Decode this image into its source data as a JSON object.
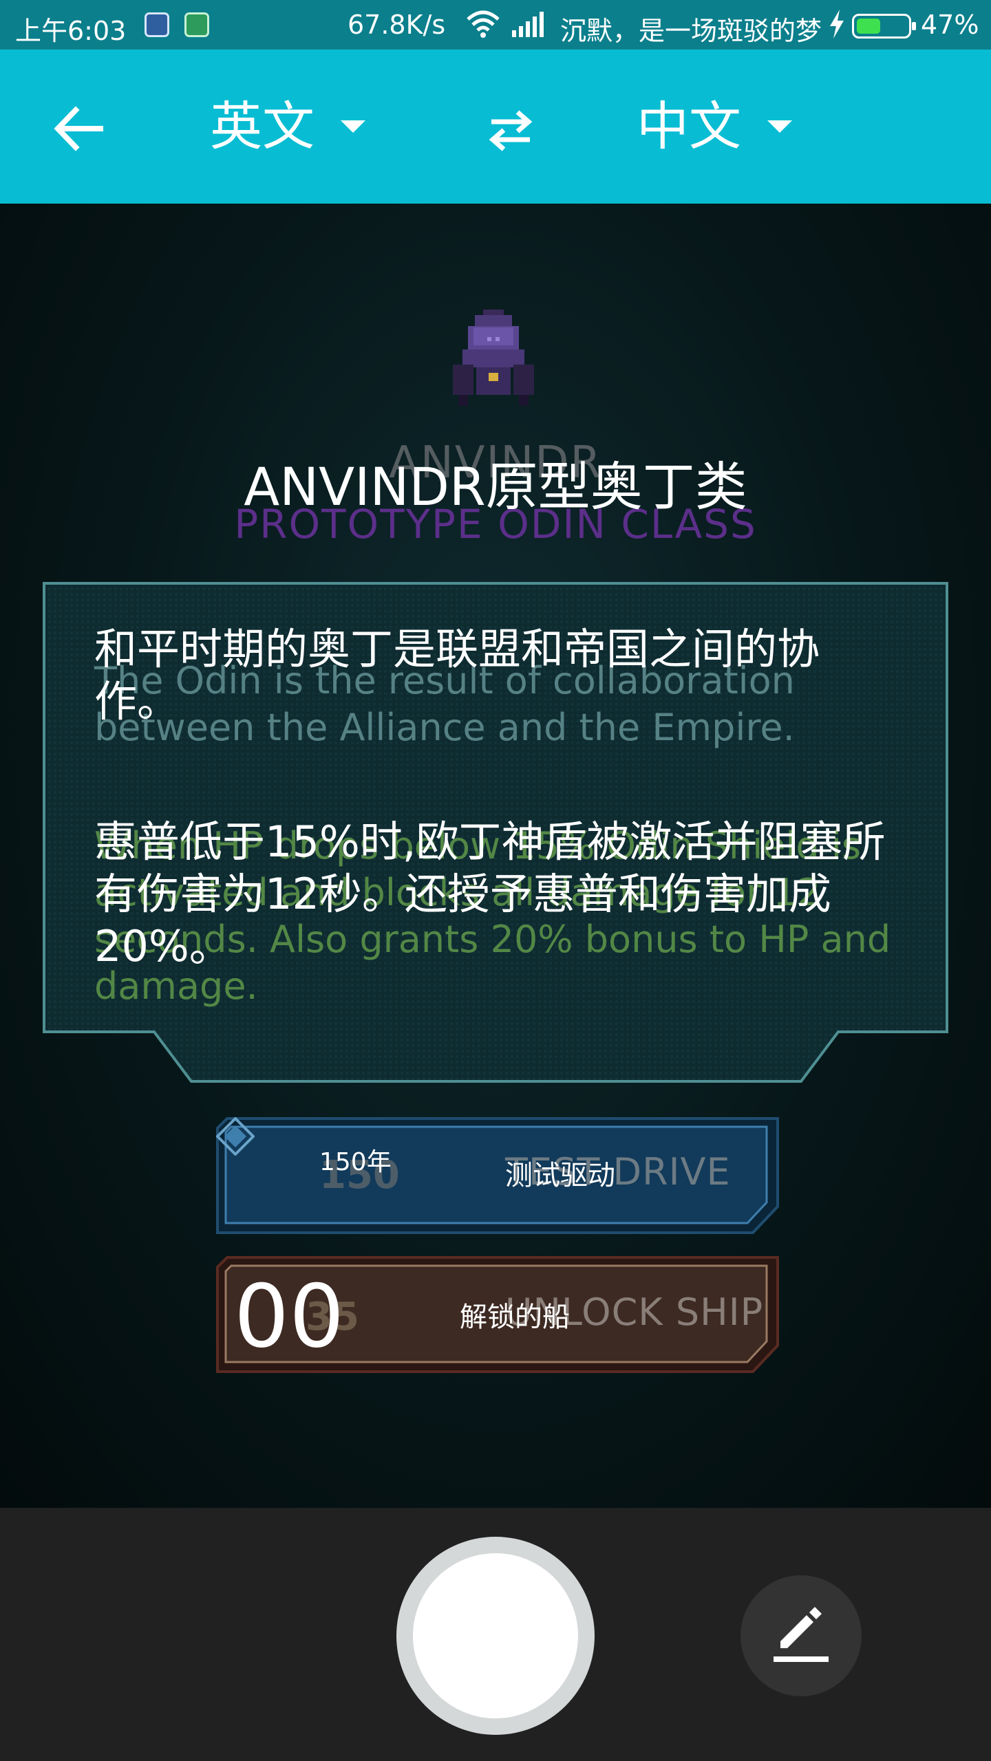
{
  "status_bar": {
    "time": "上午6:03",
    "net_speed": "67.8K/s",
    "carrier": "沉默，是一场斑驳的梦",
    "battery_pct": "47%",
    "battery_level": 0.47,
    "icons": [
      "app-icon",
      "app-icon",
      "wifi-icon",
      "signal-icon",
      "charging-bolt-icon",
      "battery-icon"
    ]
  },
  "app_bar": {
    "source_language": "英文",
    "target_language": "中文",
    "icons": [
      "back-arrow-icon",
      "dropdown-caret-icon",
      "swap-icon"
    ]
  },
  "game": {
    "ship_name_original": "ANVINDR",
    "ship_class_original": "PROTOTYPE ODIN CLASS",
    "ship_title_translated": "ANVINDR原型奥丁类",
    "description_original_1": "The Odin is the result of collaboration between the Alliance and the Empire.",
    "description_original_2": "When HP drops below 15% Odin Shield is activated and blocks all damage for 12 seconds. Also grants 20% bonus to HP and damage.",
    "description_translated_1": "和平时期的奥丁是联盟和帝国之间的协作。",
    "description_translated_2": "惠普低于15%时,欧丁神盾被激活并阻塞所有伤害为12秒。还授予惠普和伤害加成20%。",
    "test_drive": {
      "price_original": "150",
      "price_translated": "150年",
      "label_original": "TEST DRIVE",
      "label_translated": "测试驱动"
    },
    "unlock": {
      "price_original": "35",
      "price_translated": "00",
      "label_original": "UNLOCK SHIP",
      "label_translated": "解锁的船"
    }
  },
  "bottom_bar": {
    "icons": [
      "shutter-button",
      "pencil-icon"
    ]
  }
}
